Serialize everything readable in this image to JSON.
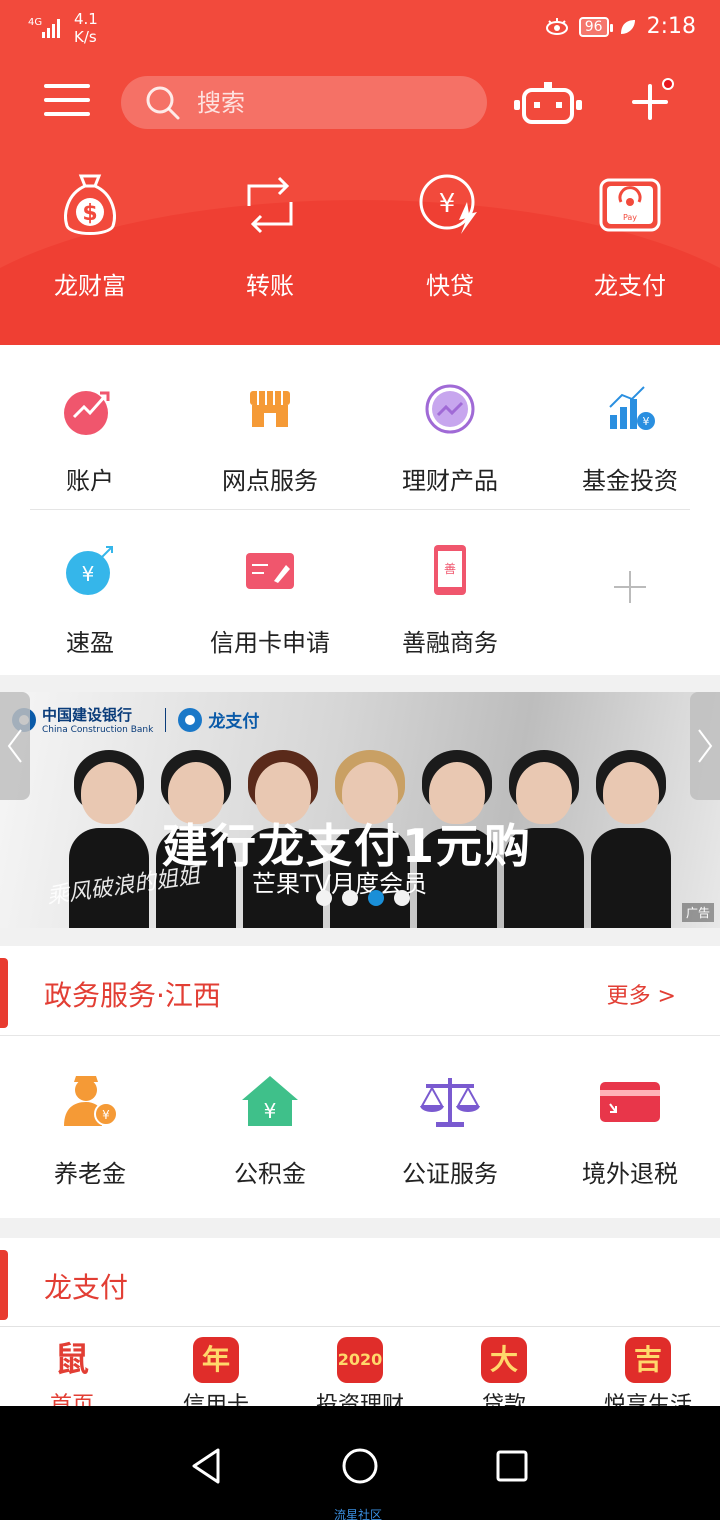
{
  "status_bar": {
    "network": "4G",
    "speed_value": "4.1",
    "speed_unit": "K/s",
    "battery": "96",
    "time": "2:18"
  },
  "header": {
    "search_placeholder": "搜索"
  },
  "top_actions": [
    {
      "label": "龙财富",
      "icon": "money-bag-icon"
    },
    {
      "label": "转账",
      "icon": "transfer-icon"
    },
    {
      "label": "快贷",
      "icon": "loan-icon"
    },
    {
      "label": "龙支付",
      "icon": "pay-icon"
    }
  ],
  "grid": {
    "row1": [
      {
        "label": "账户",
        "icon": "account-icon",
        "color": "#f0566d"
      },
      {
        "label": "网点服务",
        "icon": "store-icon",
        "color": "#f59a36"
      },
      {
        "label": "理财产品",
        "icon": "finance-icon",
        "color": "#a06ad6"
      },
      {
        "label": "基金投资",
        "icon": "fund-icon",
        "color": "#2a8fe0"
      }
    ],
    "row2": [
      {
        "label": "速盈",
        "icon": "suying-icon",
        "color": "#35b6ea"
      },
      {
        "label": "信用卡申请",
        "icon": "card-apply-icon",
        "color": "#f0566d"
      },
      {
        "label": "善融商务",
        "icon": "shanrong-icon",
        "color": "#f0566d"
      },
      {
        "label": "",
        "icon": "plus-icon",
        "color": "#bbbbbb"
      }
    ]
  },
  "banner": {
    "bank_name": "中国建设银行",
    "bank_en": "China Construction Bank",
    "brand": "龙支付",
    "headline": "建行龙支付1元购",
    "subline": "芒果TV月度会员",
    "signature": "乘风破浪的姐姐",
    "ad_tag": "广告",
    "active_dot": 2,
    "dots": 4
  },
  "gov_section": {
    "title": "政务服务·江西",
    "more": "更多 >",
    "items": [
      {
        "label": "养老金",
        "icon": "pension-icon",
        "color": "#f59a36"
      },
      {
        "label": "公积金",
        "icon": "housing-fund-icon",
        "color": "#3fc08a"
      },
      {
        "label": "公证服务",
        "icon": "scale-icon",
        "color": "#7a5ad0"
      },
      {
        "label": "境外退税",
        "icon": "tax-refund-icon",
        "color": "#e8364a"
      }
    ]
  },
  "pay_section": {
    "title": "龙支付"
  },
  "bottom_nav": [
    {
      "label": "首页",
      "glyph": "鼠",
      "active": true
    },
    {
      "label": "信用卡",
      "glyph": "年",
      "active": false
    },
    {
      "label": "投资理财",
      "glyph": "2020",
      "active": false
    },
    {
      "label": "贷款",
      "glyph": "大",
      "active": false
    },
    {
      "label": "悦享生活",
      "glyph": "吉",
      "active": false
    }
  ],
  "watermark": "流星社区"
}
